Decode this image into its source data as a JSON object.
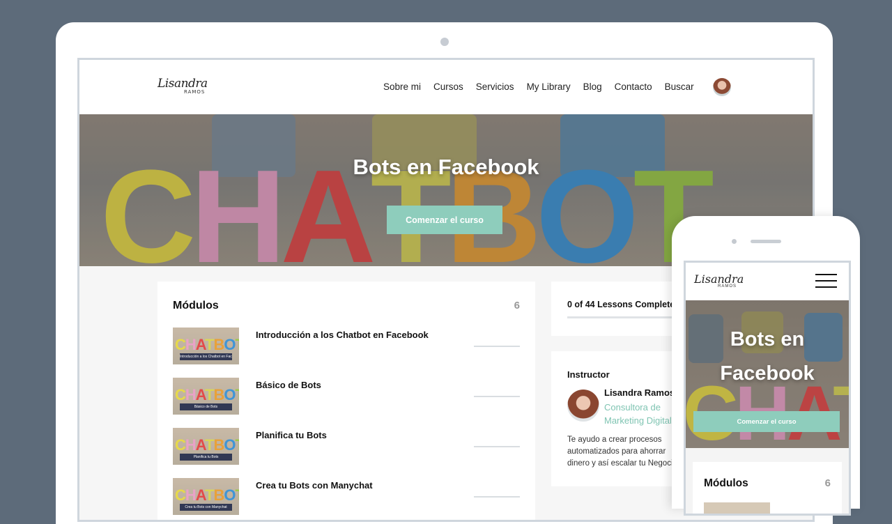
{
  "site": {
    "logo_script": "Lisandra",
    "logo_sub": "RAMOS",
    "nav": [
      "Sobre mi",
      "Cursos",
      "Servicios",
      "My Library",
      "Blog",
      "Contacto",
      "Buscar"
    ]
  },
  "hero": {
    "letters": "CHATBOT",
    "title": "Bots en Facebook",
    "cta": "Comenzar el curso"
  },
  "modules": {
    "title": "Módulos",
    "count": "6",
    "items": [
      {
        "name": "Introducción a los Chatbot en Facebook",
        "thumb_caption": "Introducción a los Chatbot en Facebook"
      },
      {
        "name": "Básico de Bots",
        "thumb_caption": "Básico de Bots"
      },
      {
        "name": "Planifica tu Bots",
        "thumb_caption": "Planifica tu Bots"
      },
      {
        "name": "Crea tu Bots con Manychat",
        "thumb_caption": "Crea tu Bots con Manychat"
      }
    ],
    "thumb_letters": "CHATBOT"
  },
  "progress": {
    "text": "0 of 44 Lessons Complete",
    "completed_fraction": 0
  },
  "instructor": {
    "heading": "Instructor",
    "name": "Lisandra Ramos",
    "role": "Consultora de Marketing Digital",
    "description": "Te ayudo a crear procesos automatizados para ahorrar dinero y así escalar tu Negocio"
  },
  "mobile": {
    "logo_script": "Lisandra",
    "logo_sub": "RAMOS",
    "hero_letters": "CHATBO",
    "title": "Bots en Facebook",
    "cta": "Comenzar el curso",
    "modules_title": "Módulos",
    "modules_count": "6"
  },
  "colors": {
    "accent": "#8ecdbc",
    "role_text": "#7fc4b2",
    "background": "#5d6b7a",
    "letters": [
      "#e7d94a",
      "#e9a2c7",
      "#e24a4a",
      "#d9d45a",
      "#e8a13a",
      "#3f95d6",
      "#9dc94a"
    ]
  }
}
